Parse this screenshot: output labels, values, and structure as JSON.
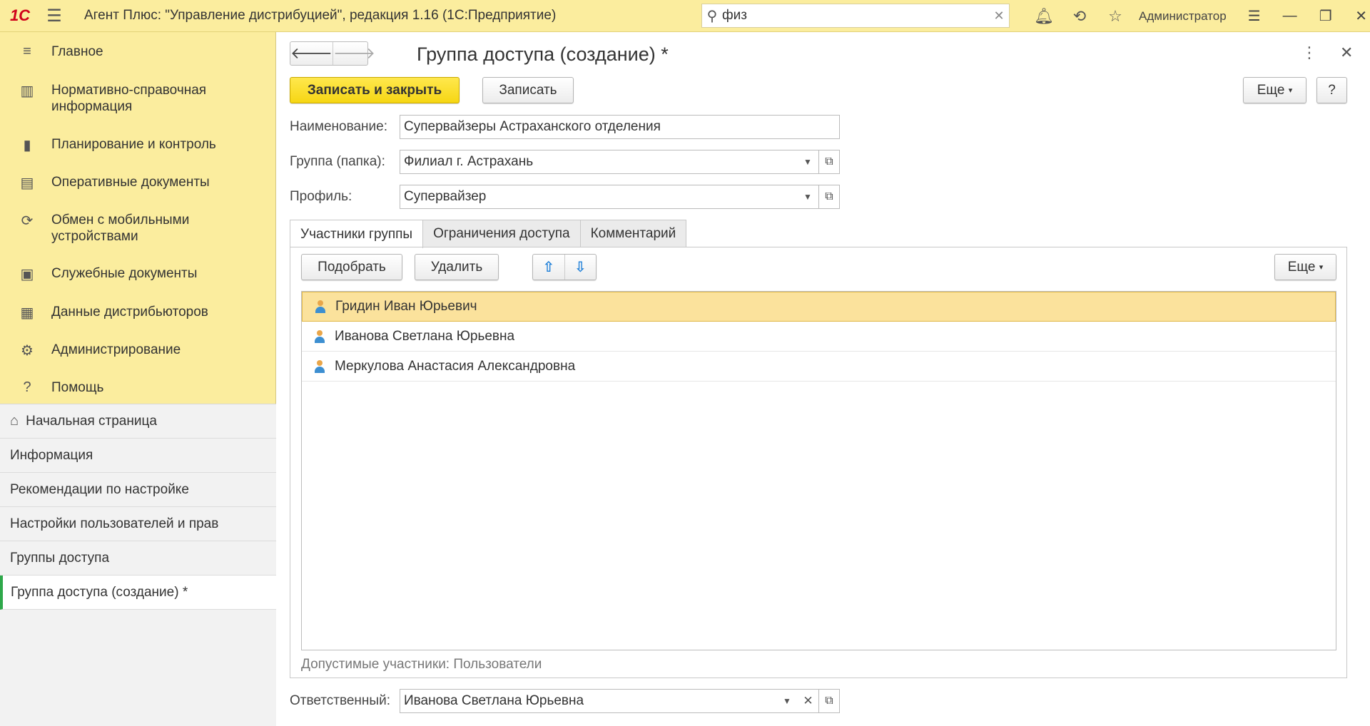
{
  "topbar": {
    "logo": "1С",
    "title": "Агент Плюс: \"Управление дистрибуцией\", редакция 1.16  (1С:Предприятие)",
    "search_value": "физ",
    "user": "Администратор"
  },
  "sections": [
    {
      "label": "Главное",
      "icon": "menu-lines-icon"
    },
    {
      "label": "Нормативно-справочная информация",
      "icon": "catalog-icon"
    },
    {
      "label": "Планирование и контроль",
      "icon": "chart-icon"
    },
    {
      "label": "Оперативные документы",
      "icon": "documents-icon"
    },
    {
      "label": "Обмен с мобильными устройствами",
      "icon": "sync-icon"
    },
    {
      "label": "Служебные документы",
      "icon": "service-docs-icon"
    },
    {
      "label": "Данные дистрибьюторов",
      "icon": "distributor-data-icon"
    },
    {
      "label": "Администрирование",
      "icon": "gear-icon"
    },
    {
      "label": "Помощь",
      "icon": "help-icon"
    }
  ],
  "nav": [
    {
      "label": "Начальная страница"
    },
    {
      "label": "Информация"
    },
    {
      "label": "Рекомендации по настройке"
    },
    {
      "label": "Настройки пользователей и прав"
    },
    {
      "label": "Группы доступа"
    },
    {
      "label": "Группа доступа (создание) *"
    }
  ],
  "form": {
    "title": "Группа доступа (создание) *",
    "save_close": "Записать и закрыть",
    "save": "Записать",
    "more": "Еще",
    "help": "?",
    "name_label": "Наименование:",
    "name_value": "Супервайзеры Астраханского отделения",
    "group_label": "Группа (папка):",
    "group_value": "Филиал г. Астрахань",
    "profile_label": "Профиль:",
    "profile_value": "Супервайзер",
    "responsible_label": "Ответственный:",
    "responsible_value": "Иванова Светлана Юрьевна"
  },
  "tabs": [
    {
      "label": "Участники группы"
    },
    {
      "label": "Ограничения доступа"
    },
    {
      "label": "Комментарий"
    }
  ],
  "members": {
    "pick": "Подобрать",
    "delete": "Удалить",
    "more": "Еще",
    "rows": [
      {
        "name": "Гридин Иван Юрьевич"
      },
      {
        "name": "Иванова Светлана Юрьевна"
      },
      {
        "name": "Меркулова Анастасия Александровна"
      }
    ],
    "hint": "Допустимые участники: Пользователи"
  }
}
